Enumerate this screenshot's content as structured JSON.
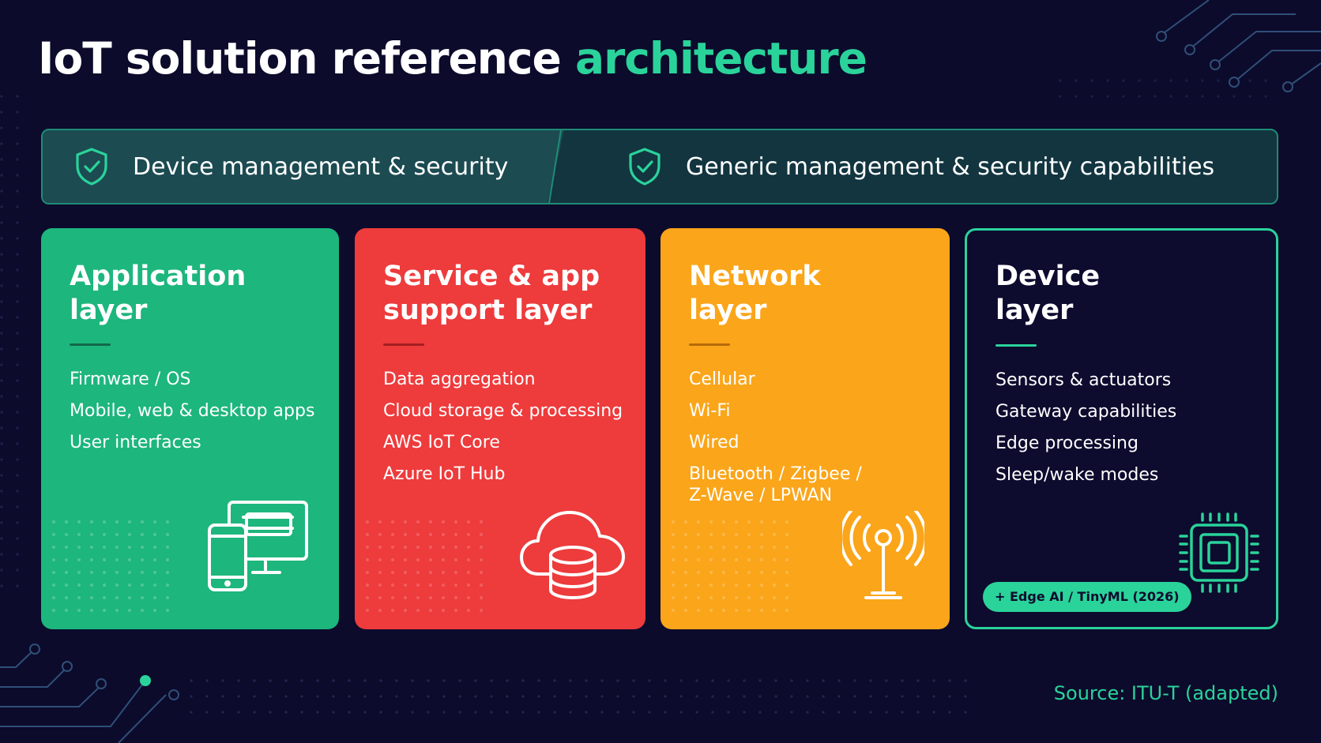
{
  "title": {
    "main": "IoT solution reference",
    "accent": "architecture"
  },
  "management": {
    "left_label": "Device management & security",
    "right_label": "Generic management & security capabilities",
    "icon": "shield-check-icon"
  },
  "layers": [
    {
      "title": "Application\nlayer",
      "items": [
        "Firmware / OS",
        "Mobile, web & desktop apps",
        "User interfaces"
      ],
      "icon": "devices-icon",
      "color": "#1db67d"
    },
    {
      "title": "Service & app\nsupport layer",
      "items": [
        "Data aggregation",
        "Cloud storage & processing",
        "AWS IoT Core",
        "Azure IoT Hub"
      ],
      "icon": "cloud-database-icon",
      "color": "#ee3b3c"
    },
    {
      "title": "Network\nlayer",
      "items": [
        "Cellular",
        "Wi-Fi",
        "Wired",
        "Bluetooth / Zigbee /\nZ-Wave / LPWAN"
      ],
      "icon": "antenna-icon",
      "color": "#fba51a"
    },
    {
      "title": "Device\nlayer",
      "items": [
        "Sensors & actuators",
        "Gateway capabilities",
        "Edge processing",
        "Sleep/wake modes"
      ],
      "icon": "chip-icon",
      "color": "#2ad39a",
      "badge": "+ Edge AI / TinyML (2026)"
    }
  ],
  "source": "Source: ITU-T (adapted)",
  "colors": {
    "background": "#0c0b2c",
    "accent": "#2ad39a"
  }
}
